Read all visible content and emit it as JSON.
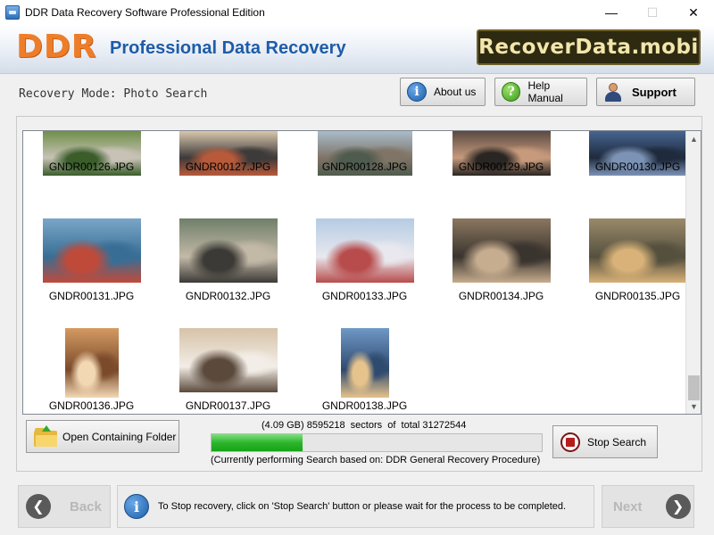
{
  "window": {
    "title": "DDR Data Recovery Software Professional Edition",
    "minimize_glyph": "—",
    "maximize_glyph": "☐",
    "close_glyph": "✕"
  },
  "header": {
    "logo": "DDR",
    "title": "Professional Data Recovery",
    "brand": "RecoverData.mobi",
    "logo_color": "#ee7d2a",
    "title_color": "#1d5ca8"
  },
  "mode": {
    "label": "Recovery Mode: Photo Search"
  },
  "toolbar": {
    "about_label": "About us",
    "help_label": "Help Manual",
    "support_label": "Support",
    "info_glyph": "i",
    "help_glyph": "?"
  },
  "gallery": {
    "files": [
      {
        "name": "GNDR00126.JPG",
        "colors": [
          "#6f8f4a",
          "#c8c2b6",
          "#3a5d2a"
        ]
      },
      {
        "name": "GNDR00127.JPG",
        "colors": [
          "#d9c7ad",
          "#3d3a3a",
          "#b85a3a"
        ]
      },
      {
        "name": "GNDR00128.JPG",
        "colors": [
          "#a9bccb",
          "#7f7466",
          "#4f5b4e"
        ]
      },
      {
        "name": "GNDR00129.JPG",
        "colors": [
          "#5a4a42",
          "#c79a7c",
          "#2a2624"
        ]
      },
      {
        "name": "GNDR00130.JPG",
        "colors": [
          "#466590",
          "#1f2a3c",
          "#7c93b6"
        ]
      },
      {
        "name": "GNDR00131.JPG",
        "colors": [
          "#7aa6c8",
          "#386e95",
          "#c04a3a"
        ]
      },
      {
        "name": "GNDR00132.JPG",
        "colors": [
          "#6f7f6a",
          "#c3b9a7",
          "#3c3a36"
        ]
      },
      {
        "name": "GNDR00133.JPG",
        "colors": [
          "#b5cbe4",
          "#e8e8ee",
          "#b84c4c"
        ]
      },
      {
        "name": "GNDR00134.JPG",
        "colors": [
          "#8b7760",
          "#3a342e",
          "#c7ad8f"
        ]
      },
      {
        "name": "GNDR00135.JPG",
        "colors": [
          "#9a8a6a",
          "#55503e",
          "#d8b278"
        ]
      },
      {
        "name": "GNDR00136.JPG",
        "colors": [
          "#d49a62",
          "#7a4a2a",
          "#f3d8b4"
        ]
      },
      {
        "name": "GNDR00137.JPG",
        "colors": [
          "#d6c2a8",
          "#f2ede6",
          "#5b4a3c"
        ]
      },
      {
        "name": "GNDR00138.JPG",
        "colors": [
          "#6f98c6",
          "#2e4a6e",
          "#e6c38c"
        ]
      }
    ]
  },
  "progress": {
    "sectors_text": "(4.09 GB) 8595218  sectors  of  total 31272544",
    "fraction": 0.2748,
    "procedure_text": "(Currently performing Search based on:  DDR General Recovery Procedure)"
  },
  "actions": {
    "open_folder_label": "Open Containing Folder",
    "stop_label": "Stop Search"
  },
  "footer": {
    "back_label": "Back",
    "next_label": "Next",
    "back_glyph": "❮",
    "next_glyph": "❯",
    "status_glyph": "i",
    "status_text": "To Stop recovery, click on 'Stop Search' button or please wait for the process to be completed."
  }
}
